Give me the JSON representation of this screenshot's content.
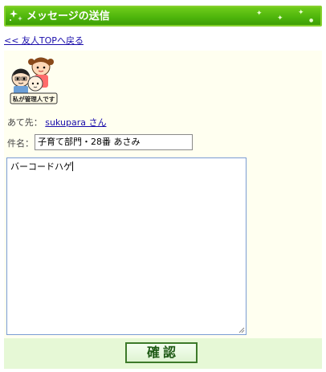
{
  "header": {
    "title": "メッセージの送信"
  },
  "nav": {
    "back_link": "<< 友人TOPへ戻る"
  },
  "badge": {
    "icon": "family-illustration-icon",
    "caption": "私が管理人です"
  },
  "recipient": {
    "label": "あて先：",
    "name": "sukupara さん"
  },
  "subject": {
    "label": "件名：",
    "value": "子育て部門・28番 あさみ"
  },
  "message": {
    "value": "バーコードハゲ"
  },
  "actions": {
    "confirm_label": "確認"
  },
  "colors": {
    "title_bar": "#4fb60c",
    "panel_bg": "#fffff0",
    "footer_bg": "#e6f8d6",
    "link": "#1a0dab"
  }
}
